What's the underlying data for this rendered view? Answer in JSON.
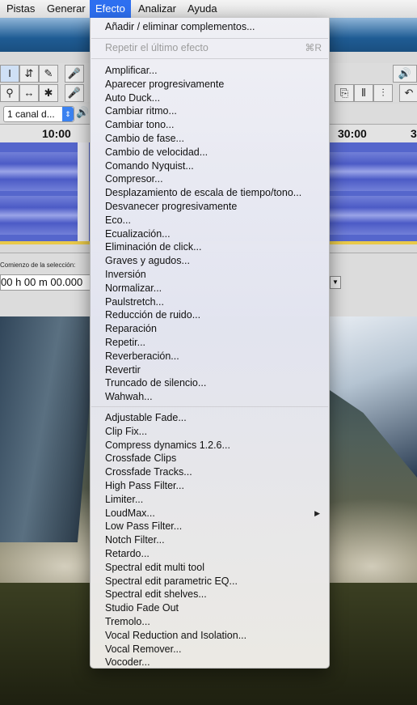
{
  "menubar": {
    "items": [
      {
        "label": "Pistas"
      },
      {
        "label": "Generar"
      },
      {
        "label": "Efecto"
      },
      {
        "label": "Analizar"
      },
      {
        "label": "Ayuda"
      }
    ]
  },
  "toolbar": {
    "channel_select": "1 canal d...",
    "cursor_tool_icon": "I",
    "multi_tool_icon": "✱"
  },
  "ruler": {
    "left_time": "10:00",
    "right_time": "30:00",
    "right_partial": "3"
  },
  "selection": {
    "label": "Comienzo de la selección:",
    "time_value": "00 h 00 m 00.000"
  },
  "efecto_menu": {
    "header_items": [
      {
        "label": "Añadir / eliminar complementos...",
        "enabled": true
      }
    ],
    "repeat": {
      "label": "Repetir el último efecto",
      "shortcut": "⌘R",
      "enabled": false
    },
    "builtin_effects": [
      "Amplificar...",
      "Aparecer progresivamente",
      "Auto Duck...",
      "Cambiar ritmo...",
      "Cambiar tono...",
      "Cambio de fase...",
      "Cambio de velocidad...",
      "Comando Nyquist...",
      "Compresor...",
      "Desplazamiento de escala de tiempo/tono...",
      "Desvanecer progresivamente",
      "Eco...",
      "Ecualización...",
      "Eliminación de click...",
      "Graves y agudos...",
      "Inversión",
      "Normalizar...",
      "Paulstretch...",
      "Reducción de ruido...",
      "Reparación",
      "Repetir...",
      "Reverberación...",
      "Revertir",
      "Truncado de silencio...",
      "Wahwah..."
    ],
    "plugin_effects": [
      {
        "label": "Adjustable Fade...",
        "submenu": false
      },
      {
        "label": "Clip Fix...",
        "submenu": false
      },
      {
        "label": "Compress dynamics 1.2.6...",
        "submenu": false
      },
      {
        "label": "Crossfade Clips",
        "submenu": false
      },
      {
        "label": "Crossfade Tracks...",
        "submenu": false
      },
      {
        "label": "High Pass Filter...",
        "submenu": false
      },
      {
        "label": "Limiter...",
        "submenu": false
      },
      {
        "label": "LoudMax...",
        "submenu": true
      },
      {
        "label": "Low Pass Filter...",
        "submenu": false
      },
      {
        "label": "Notch Filter...",
        "submenu": false
      },
      {
        "label": "Retardo...",
        "submenu": false
      },
      {
        "label": "Spectral edit multi tool",
        "submenu": false
      },
      {
        "label": "Spectral edit parametric EQ...",
        "submenu": false
      },
      {
        "label": "Spectral edit shelves...",
        "submenu": false
      },
      {
        "label": "Studio Fade Out",
        "submenu": false
      },
      {
        "label": "Tremolo...",
        "submenu": false
      },
      {
        "label": "Vocal Reduction and Isolation...",
        "submenu": false
      },
      {
        "label": "Vocal Remover...",
        "submenu": false
      },
      {
        "label": "Vocoder...",
        "submenu": false
      }
    ],
    "submenu_arrow": "▶"
  },
  "colors": {
    "menubar_highlight": "#2d6ff0",
    "waveform": "#5566cc"
  }
}
